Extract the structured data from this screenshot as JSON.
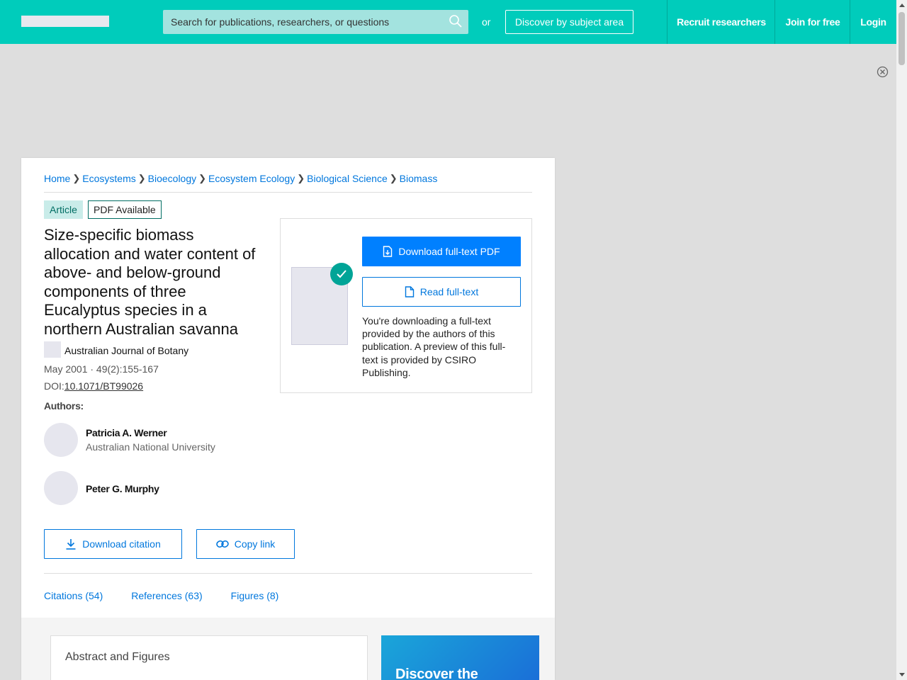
{
  "header": {
    "search_placeholder": "Search for publications, researchers, or questions",
    "or_text": "or",
    "discover_label": "Discover by subject area",
    "nav": [
      "Recruit researchers",
      "Join for free",
      "Login"
    ]
  },
  "breadcrumb": [
    "Home",
    "Ecosystems",
    "Bioecology",
    "Ecosystem Ecology",
    "Biological Science",
    "Biomass"
  ],
  "badges": {
    "type": "Article",
    "pdf": "PDF Available"
  },
  "article": {
    "title": "Size-specific biomass allocation and water content of above- and below-ground components of three Eucalyptus species in a northern Australian savanna",
    "journal": "Australian Journal of Botany",
    "meta": "May 2001 · 49(2):155-167",
    "doi_label": "DOI:",
    "doi": "10.1071/BT99026",
    "authors_label": "Authors:",
    "authors": [
      {
        "name": "Patricia A. Werner",
        "institution": "Australian National University"
      },
      {
        "name": "Peter G. Murphy",
        "institution": ""
      }
    ]
  },
  "actions": {
    "download_citation": "Download citation",
    "copy_link": "Copy link"
  },
  "tabs": [
    "Citations (54)",
    "References (63)",
    "Figures (8)"
  ],
  "download_panel": {
    "pdf_button": "Download full-text PDF",
    "read_button": "Read full-text",
    "note": "You're downloading a full-text provided by the authors of this publication. A preview of this full-text is provided by CSIRO Publishing."
  },
  "lower": {
    "abstract_title": "Abstract and Figures",
    "promo_text": "Discover the"
  },
  "colors": {
    "brand": "#00ccbb",
    "link": "#0077dd",
    "primary_button": "#0080ff",
    "check": "#00a497"
  }
}
